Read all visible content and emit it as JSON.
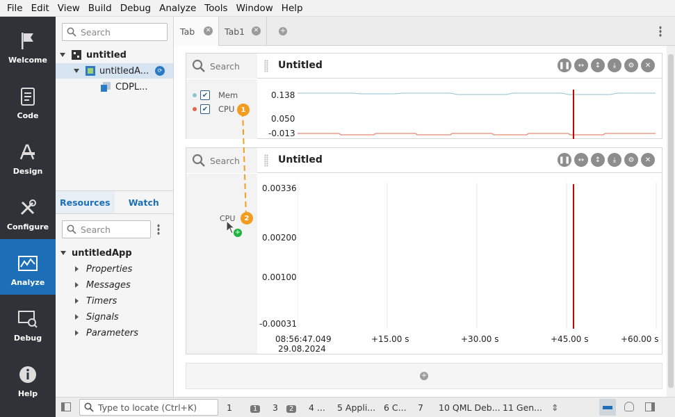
{
  "menu": [
    "File",
    "Edit",
    "View",
    "Build",
    "Debug",
    "Analyze",
    "Tools",
    "Window",
    "Help"
  ],
  "modes": [
    {
      "label": "Welcome",
      "icon": "flag-icon"
    },
    {
      "label": "Code",
      "icon": "document-icon"
    },
    {
      "label": "Design",
      "icon": "design-icon"
    },
    {
      "label": "Configure",
      "icon": "wrench-icon"
    },
    {
      "label": "Analyze",
      "icon": "analyze-icon"
    },
    {
      "label": "Debug",
      "icon": "debug-icon"
    },
    {
      "label": "Help",
      "icon": "info-icon"
    }
  ],
  "left": {
    "search_placeholder": "Search",
    "tree": {
      "root": "untitled",
      "child": "untitledA...",
      "leaf": "CDPL..."
    },
    "tabs": {
      "resources": "Resources",
      "watch": "Watch"
    },
    "search2_placeholder": "Search",
    "app": "untitledApp",
    "items": [
      "Properties",
      "Messages",
      "Timers",
      "Signals",
      "Parameters"
    ]
  },
  "tabs": [
    {
      "label": "Tab"
    },
    {
      "label": "Tab1"
    }
  ],
  "panel1": {
    "search": "Search",
    "title": "Untitled",
    "legend": [
      {
        "name": "Mem",
        "color": "#8fc3cf"
      },
      {
        "name": "CPU",
        "color": "#e06b4f"
      }
    ],
    "yticks": [
      "0.138",
      "0.050",
      "-0.013"
    ]
  },
  "panel2": {
    "search": "Search",
    "title": "Untitled",
    "drag_label": "CPU",
    "yticks": [
      "0.00336",
      "0.00200",
      "0.00100",
      "-0.00031"
    ],
    "xticks": [
      "08:56:47.049",
      "+15.00 s",
      "+30.00 s",
      "+45.00 s",
      "+60.00 s"
    ],
    "date": "29.08.2024"
  },
  "badges": {
    "one": "1",
    "two": "2"
  },
  "status": {
    "locate_placeholder": "Type to locate (Ctrl+K)",
    "items": [
      "1",
      "1",
      "3",
      "2",
      "4 ...",
      "5 Appli...",
      "6 C...",
      "7",
      "10 QML Deb...",
      "11 Gen..."
    ]
  },
  "colors": {
    "accent": "#1c6fb6",
    "cursor_line": "#cc0000",
    "badge": "#f39c1f"
  }
}
